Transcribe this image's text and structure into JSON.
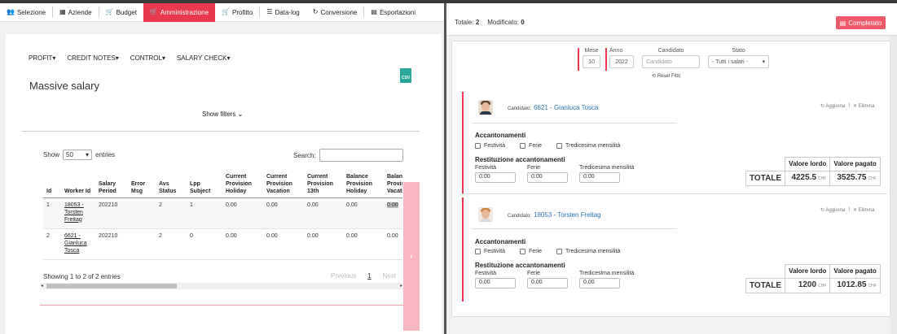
{
  "nav": {
    "items": [
      {
        "label": "Selezione",
        "icon": "users-icon"
      },
      {
        "label": "Aziende",
        "icon": "building-icon"
      },
      {
        "label": "Budget",
        "icon": "cart-icon"
      },
      {
        "label": "Amministrazione",
        "icon": "cart-icon",
        "active": true
      },
      {
        "label": "Profitto",
        "icon": "cart-icon"
      },
      {
        "label": "Data-log",
        "icon": "list-icon"
      },
      {
        "label": "Conversione",
        "icon": "refresh-icon"
      },
      {
        "label": "Esportazioni",
        "icon": "file-icon"
      }
    ]
  },
  "menu": {
    "profit": "PROFIT",
    "credit_notes": "CREDIT NOTES",
    "control": "CONTROL",
    "salary_check": "SALARY CHECK"
  },
  "page": {
    "title": "Massive salary",
    "csv": "CSV",
    "show_filters": "Show filters"
  },
  "table": {
    "show_label": "Show",
    "entries_label": "entries",
    "page_size": "50",
    "search_label": "Search:",
    "columns": [
      "Id",
      "Worker Id",
      "Salary Period",
      "Error Msg",
      "Avs Status",
      "Lpp Subject",
      "Current Provision Holiday",
      "Current Provision Vacation",
      "Current Provision 13th",
      "Balance Provision Holiday",
      "Balance Provision Vacation"
    ],
    "rows": [
      {
        "id": "1",
        "worker": "18053 - Torsten Freitag",
        "period": "202210",
        "error": "",
        "avs": "2",
        "lpp": "1",
        "cph": "0.00",
        "cpv": "0.00",
        "cp13": "0.00",
        "bph": "0.00",
        "bpv": "0.00"
      },
      {
        "id": "2",
        "worker": "6621 - Gianluca Tosca",
        "period": "202210",
        "error": "",
        "avs": "2",
        "lpp": "0",
        "cph": "0.00",
        "cpv": "0.00",
        "cp13": "0.00",
        "bph": "0.00",
        "bpv": "0.00"
      }
    ],
    "info": "Showing 1 to 2 of 2 entries",
    "pager": {
      "previous": "Previous",
      "current": "1",
      "next": "Next"
    }
  },
  "right": {
    "totale_label": "Totale:",
    "totale": "2",
    "modificato_label": "Modificato:",
    "modificato": "0",
    "completato": "Completato",
    "filters": {
      "mese_label": "Mese",
      "mese": "10",
      "anno_label": "Anno",
      "anno": "2022",
      "candidato_label": "Candidato",
      "candidato_placeholder": "Candidato",
      "stato_label": "Stato",
      "stato": "- Tutti i salari -",
      "reset": "Reset Filtri"
    },
    "cards": [
      {
        "candidate_label": "Candidato:",
        "candidate": "6621 - Gianluca Tosca",
        "aggiorna": "Aggiorna",
        "elimina": "Elimina",
        "acc_title": "Accantonamenti",
        "chk_festivita": "Festività",
        "chk_ferie": "Ferie",
        "chk_tredicesima": "Tredicesima mensilità",
        "rest_title": "Restituzione accantonamenti",
        "rest_festivita_label": "Festività",
        "rest_festivita": "0.00",
        "rest_ferie_label": "Ferie",
        "rest_ferie": "0.00",
        "rest_tredicesima_label": "Tredicesima mensilità",
        "rest_tredicesima": "0.00",
        "valore_lordo_label": "Valore lordo",
        "valore_pagato_label": "Valore pagato",
        "totale_label": "TOTALE",
        "valore_lordo": "4225.5",
        "valore_pagato": "3525.75",
        "currency": "CHF"
      },
      {
        "candidate_label": "Candidato:",
        "candidate": "18053 - Torsten Freitag",
        "aggiorna": "Aggiorna",
        "elimina": "Elimina",
        "acc_title": "Accantonamenti",
        "chk_festivita": "Festività",
        "chk_ferie": "Ferie",
        "chk_tredicesima": "Tredicesima mensilità",
        "rest_title": "Restituzione accantonamenti",
        "rest_festivita_label": "Festività",
        "rest_festivita": "0.00",
        "rest_ferie_label": "Ferie",
        "rest_ferie": "0.00",
        "rest_tredicesima_label": "Tredicesima mensilità",
        "rest_tredicesima": "0.00",
        "valore_lordo_label": "Valore lordo",
        "valore_pagato_label": "Valore pagato",
        "totale_label": "TOTALE",
        "valore_lordo": "1200",
        "valore_pagato": "1012.85",
        "currency": "CHF"
      }
    ]
  },
  "colors": {
    "accent": "#e8394d",
    "button": "#ef5b6a",
    "link": "#2a74b8",
    "csv": "#2aa79b",
    "side_tab": "#f8b7c0"
  }
}
